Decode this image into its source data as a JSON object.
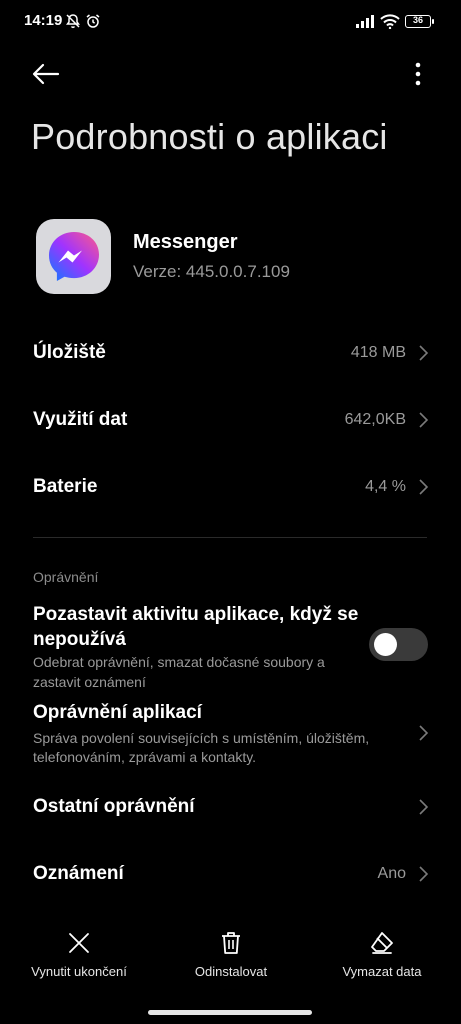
{
  "status_bar": {
    "time": "14:19",
    "battery": "36"
  },
  "header": {
    "title": "Podrobnosti o aplikaci"
  },
  "app": {
    "name": "Messenger",
    "version": "Verze: 445.0.0.7.109",
    "icon": "messenger-logo"
  },
  "rows": [
    {
      "label": "Úložiště",
      "value": "418 MB"
    },
    {
      "label": "Využití dat",
      "value": "642,0KB"
    },
    {
      "label": "Baterie",
      "value": "4,4 %"
    }
  ],
  "permissions": {
    "section_title": "Oprávnění",
    "pause": {
      "title": "Pozastavit aktivitu aplikace, když se nepoužívá",
      "description": "Odebrat oprávnění, smazat dočasné soubory a zastavit oznámení",
      "enabled": false
    },
    "app_permissions": {
      "title": "Oprávnění aplikací",
      "description": "Správa povolení souvisejících s umístěním, úložištěm, telefonováním, zprávami a kontakty."
    },
    "other": {
      "title": "Ostatní oprávnění"
    },
    "notifications": {
      "title": "Oznámení",
      "value": "Ano"
    }
  },
  "bottom_actions": {
    "force_stop": "Vynutit ukončení",
    "uninstall": "Odinstalovat",
    "clear_data": "Vymazat data"
  },
  "colors": {
    "background": "#000000",
    "secondary_text": "#9a9a9a",
    "toggle_off": "#3a3a3a"
  }
}
